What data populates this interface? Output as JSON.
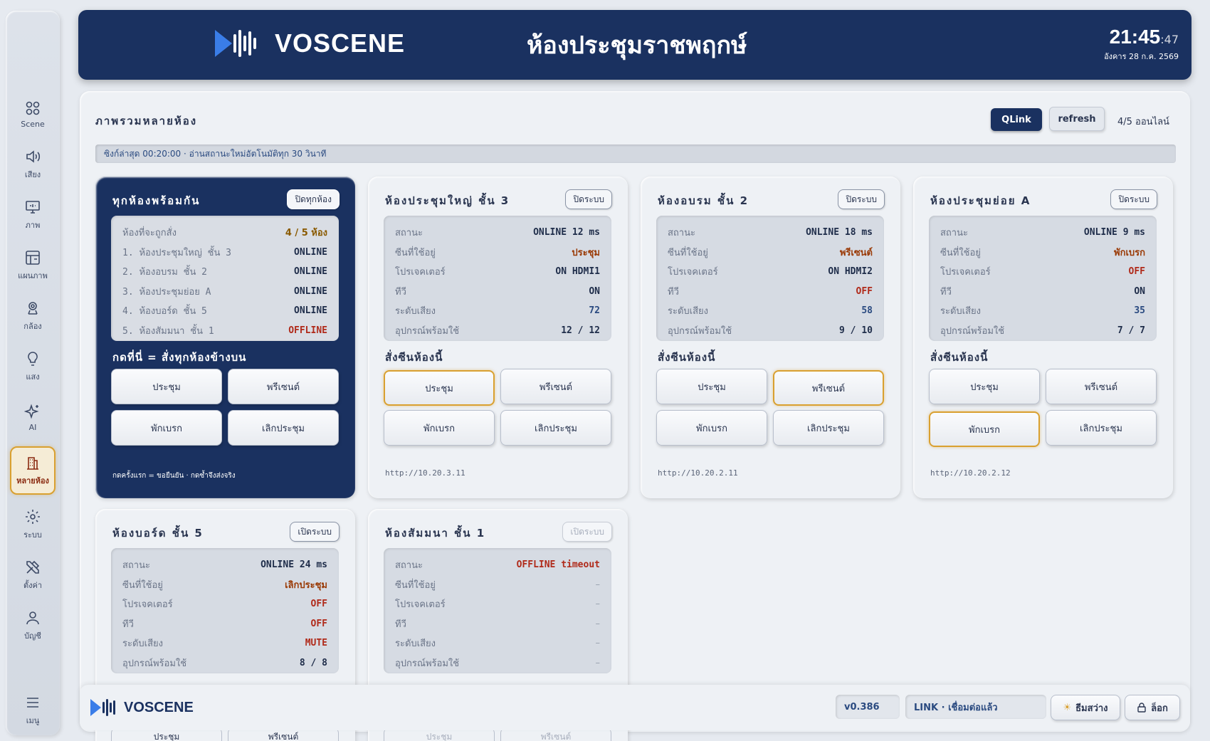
{
  "sidebar": {
    "items": [
      {
        "label": "Scene",
        "icon": "scene-icon"
      },
      {
        "label": "เสียง",
        "icon": "speaker-icon"
      },
      {
        "label": "ภาพ",
        "icon": "monitor-icon"
      },
      {
        "label": "แผนภาพ",
        "icon": "layout-icon"
      },
      {
        "label": "กล้อง",
        "icon": "camera-icon"
      },
      {
        "label": "แสง",
        "icon": "bulb-icon"
      },
      {
        "label": "AI",
        "icon": "sparkle-icon"
      },
      {
        "label": "หลายห้อง",
        "icon": "building-icon",
        "active": true
      },
      {
        "label": "ระบบ",
        "icon": "gear-icon"
      },
      {
        "label": "ตั้งค่า",
        "icon": "tools-icon"
      },
      {
        "label": "บัญชี",
        "icon": "user-icon"
      },
      {
        "label": "เมนู",
        "icon": "menu-icon"
      }
    ]
  },
  "header": {
    "brand": "VOSCENE",
    "room": "ห้องประชุมราชพฤกษ์",
    "time": "21:45",
    "seconds": ":47",
    "date": "อังคาร 28 ก.ค. 2569"
  },
  "main": {
    "title": "ภาพรวมหลายห้อง",
    "qlink": "QLink",
    "refresh": "refresh",
    "online": "4/5 ออนไลน์",
    "sync": "ซิงก์ล่าสุด 00:20:00 · อ่านสถานะใหม่อัตโนมัติทุก 30 วินาที"
  },
  "all_card": {
    "title": "ทุกห้องพร้อมกัน",
    "btn": "ปิดทุกห้อง",
    "rows": [
      {
        "k": "ห้องที่จะถูกสั่ง",
        "v": "4 / 5 ห้อง"
      },
      {
        "k": "1. ห้องประชุมใหญ่ ชั้น 3",
        "v": "ONLINE"
      },
      {
        "k": "2. ห้องอบรม ชั้น 2",
        "v": "ONLINE"
      },
      {
        "k": "3. ห้องประชุมย่อย A",
        "v": "ONLINE"
      },
      {
        "k": "4. ห้องบอร์ด ชั้น 5",
        "v": "ONLINE"
      },
      {
        "k": "5. ห้องสัมมนา ชั้น 1",
        "v": "OFFLINE"
      }
    ],
    "cmd_title": "กดที่นี่ = สั่งทุกห้องข้างบน",
    "scenes": [
      "ประชุม",
      "พรีเซนต์",
      "พักเบรก",
      "เลิกประชุม"
    ],
    "note": "กดครั้งแรก = ขอยืนยัน · กดซ้ำจึงส่งจริง"
  },
  "labels": {
    "status": "สถานะ",
    "scene": "ซีนที่ใช้อยู่",
    "projector": "โปรเจคเตอร์",
    "tv": "ทีวี",
    "volume": "ระดับเสียง",
    "devices": "อุปกรณ์พร้อมใช้",
    "cmd_title": "สั่งซีนห้องนี้"
  },
  "rooms": [
    {
      "title": "ห้องประชุมใหญ่ ชั้น 3",
      "btn": "ปิดระบบ",
      "status": "ONLINE 12 ms",
      "scene": "ประชุม",
      "projector": "ON HDMI1",
      "tv": "ON",
      "volume": "72",
      "devices": "12 / 12",
      "url": "http://10.20.3.11",
      "scenes": [
        "ประชุม",
        "พรีเซนต์",
        "พักเบรก",
        "เลิกประชุม"
      ],
      "active": 0
    },
    {
      "title": "ห้องอบรม ชั้น 2",
      "btn": "ปิดระบบ",
      "status": "ONLINE 18 ms",
      "scene": "พรีเซนต์",
      "projector": "ON HDMI2",
      "tv": "OFF",
      "volume": "58",
      "devices": "9 / 10",
      "url": "http://10.20.2.11",
      "scenes": [
        "ประชุม",
        "พรีเซนต์",
        "พักเบรก",
        "เลิกประชุม"
      ],
      "active": 1
    },
    {
      "title": "ห้องประชุมย่อย A",
      "btn": "ปิดระบบ",
      "status": "ONLINE 9 ms",
      "scene": "พักเบรก",
      "projector": "OFF",
      "tv": "ON",
      "volume": "35",
      "devices": "7 / 7",
      "url": "http://10.20.2.12",
      "scenes": [
        "ประชุม",
        "พรีเซนต์",
        "พักเบรก",
        "เลิกประชุม"
      ],
      "active": 2
    },
    {
      "title": "ห้องบอร์ด ชั้น 5",
      "btn": "เปิดระบบ",
      "status": "ONLINE 24 ms",
      "scene": "เลิกประชุม",
      "projector": "OFF",
      "tv": "OFF",
      "volume": "MUTE",
      "devices": "8 / 8",
      "scenes": [
        "ประชุม",
        "พรีเซนต์"
      ]
    },
    {
      "title": "ห้องสัมมนา ชั้น 1",
      "btn": "เปิดระบบ",
      "status": "OFFLINE timeout",
      "scene": "–",
      "projector": "–",
      "tv": "–",
      "volume": "–",
      "devices": "–",
      "scenes": [
        "ประชุม",
        "พรีเซนต์"
      ]
    }
  ],
  "footer": {
    "brand": "VOSCENE",
    "version": "v0.386",
    "link": "LINK · เชื่อมต่อแล้ว",
    "theme": "ธีมสว่าง",
    "lock": "ล็อก"
  },
  "colors": {
    "navy": "#1a3160",
    "accent": "#d9a030",
    "offline": "#b02a1a"
  }
}
